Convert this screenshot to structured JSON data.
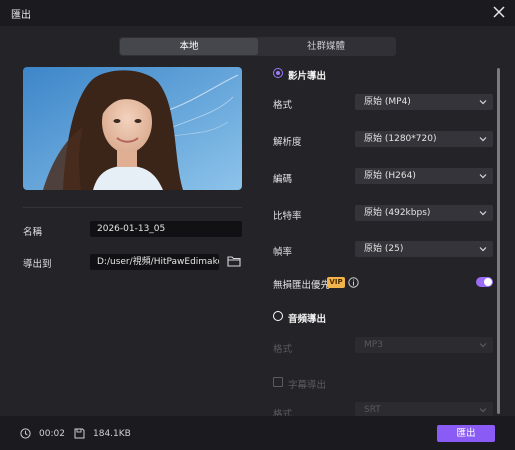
{
  "window": {
    "title": "匯出",
    "close_icon": "close-icon"
  },
  "tabs": [
    {
      "label": "本地",
      "active": true
    },
    {
      "label": "社群媒體",
      "active": false
    }
  ],
  "left": {
    "name_label": "名稱",
    "name_value": "2026-01-13_05",
    "export_to_label": "導出到",
    "export_path": "D:/user/視頻/HitPawEdimakor",
    "folder_icon": "folder-icon"
  },
  "video": {
    "section_label": "影片導出",
    "selected": true,
    "rows": [
      {
        "label": "格式",
        "value": "原始 (MP4)"
      },
      {
        "label": "解析度",
        "value": "原始 (1280*720)"
      },
      {
        "label": "編碼",
        "value": "原始 (H264)"
      },
      {
        "label": "比特率",
        "value": "原始 (492kbps)"
      },
      {
        "label": "幀率",
        "value": "原始 (25)"
      }
    ],
    "lossless_label": "無損匯出優先",
    "vip_badge": "VIP",
    "lossless_on": true
  },
  "audio": {
    "section_label": "音頻導出",
    "selected": false,
    "format_label": "格式",
    "format_value": "MP3"
  },
  "subtitle": {
    "checkbox_label": "字幕導出",
    "checked": false,
    "format_label": "格式",
    "format_value": "SRT"
  },
  "footer": {
    "duration": "00:02",
    "size": "184.1KB",
    "export_button": "匯出"
  },
  "colors": {
    "accent": "#8a5cf5",
    "vip": "#f0b44a",
    "background": "#232328"
  }
}
